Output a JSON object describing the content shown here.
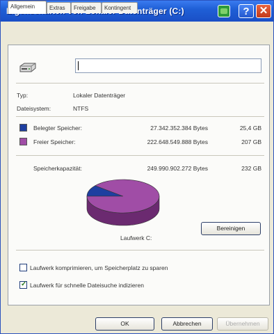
{
  "window": {
    "title": "Eigenschaften von Lokaler Datenträger (C:)",
    "help_label": "?",
    "close_label": "✕"
  },
  "tabs": [
    {
      "label": "Allgemein",
      "active": true
    },
    {
      "label": "Extras",
      "active": false
    },
    {
      "label": "Freigabe",
      "active": false
    },
    {
      "label": "Kontingent",
      "active": false
    }
  ],
  "general": {
    "drive_name_value": "",
    "type_label": "Typ:",
    "type_value": "Lokaler Datenträger",
    "filesystem_label": "Dateisystem:",
    "filesystem_value": "NTFS",
    "used_label": "Belegter Speicher:",
    "used_bytes": "27.342.352.384 Bytes",
    "used_gb": "25,4 GB",
    "used_color": "#1e3fa0",
    "free_label": "Freier Speicher:",
    "free_bytes": "222.648.549.888 Bytes",
    "free_gb": "207 GB",
    "free_color": "#a04da6",
    "capacity_label": "Speicherkapazität:",
    "capacity_bytes": "249.990.902.272 Bytes",
    "capacity_gb": "232 GB",
    "drive_caption": "Laufwerk C:",
    "cleanup_button": "Bereinigen",
    "compress_label": "Laufwerk komprimieren, um Speicherplatz zu sparen",
    "compress_checked": false,
    "index_label": "Laufwerk für schnelle Dateisuche indizieren",
    "index_checked": true
  },
  "chart_data": {
    "type": "pie",
    "categories": [
      "Belegter Speicher",
      "Freier Speicher"
    ],
    "values": [
      27342352384,
      222648549888
    ]
  },
  "footer": {
    "ok_button": "OK",
    "cancel_button": "Abbrechen",
    "apply_button": "Übernehmen"
  }
}
